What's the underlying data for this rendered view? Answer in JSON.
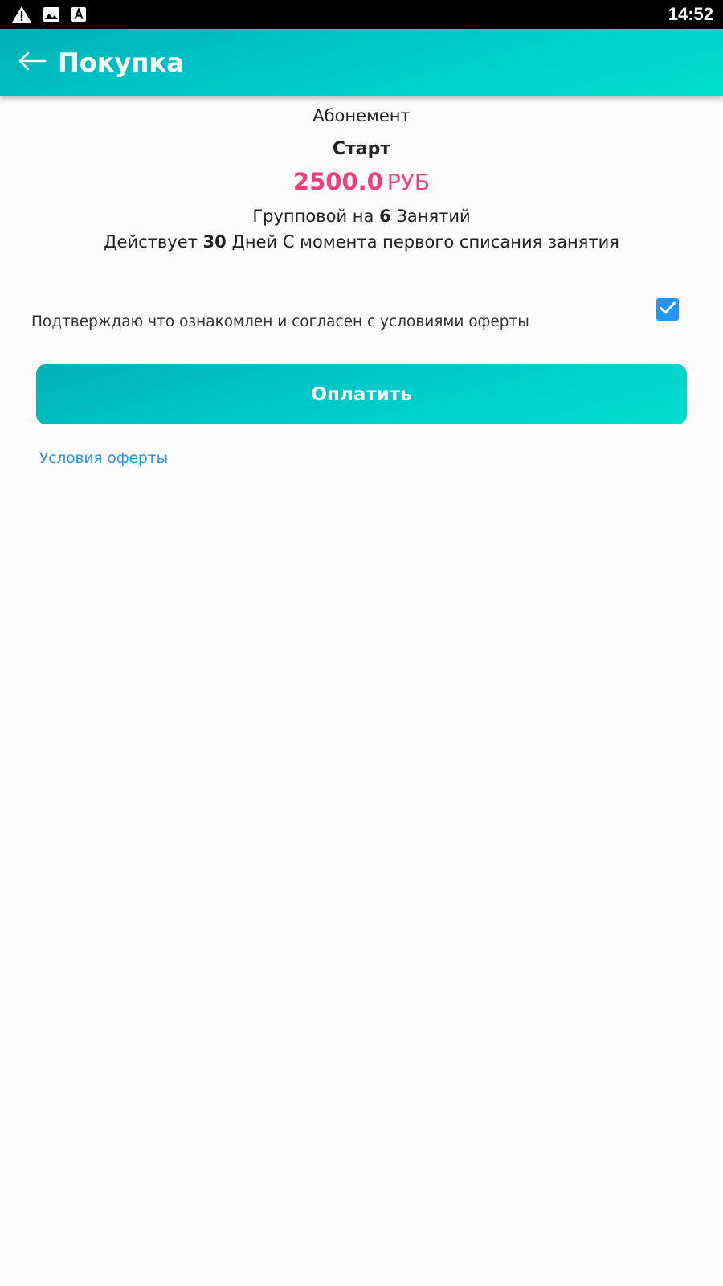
{
  "status_bar": {
    "time": "14:52",
    "icons": [
      "warning-icon",
      "image-icon",
      "font-icon"
    ]
  },
  "app_bar": {
    "title": "Покупка",
    "back_icon": "arrow-back-icon"
  },
  "subscription": {
    "type_label": "Абонемент",
    "name": "Старт",
    "price_value": "2500.0",
    "price_currency": "РУБ",
    "lessons_prefix": "Групповой на",
    "lessons_count": "6",
    "lessons_suffix": "Занятий",
    "validity_prefix": "Действует",
    "validity_days": "30",
    "validity_suffix": "Дней С момента первого списания занятия"
  },
  "agreement": {
    "text": "Подтверждаю что ознакомлен и согласен с условиями оферты",
    "checked": true
  },
  "pay_button": {
    "label": "Оплатить"
  },
  "offer_link": {
    "label": "Условия оферты"
  },
  "colors": {
    "accent_gradient_start": "#00b0b9",
    "accent_gradient_end": "#00dfcf",
    "price": "#ee3f7c",
    "checkbox": "#2196f3",
    "link": "#2196f3"
  }
}
